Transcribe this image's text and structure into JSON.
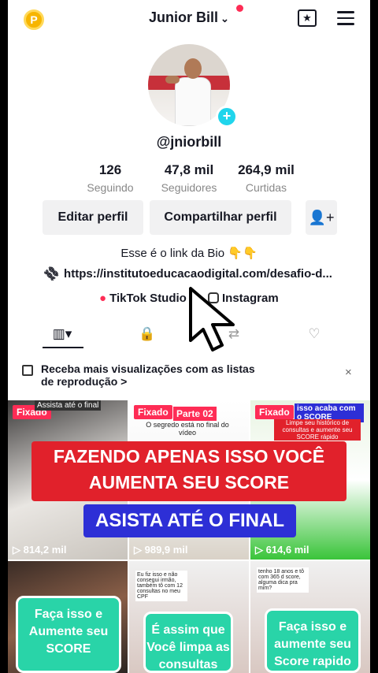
{
  "header": {
    "coin_label": "P",
    "username": "Junior Bill",
    "chevron": "⌄",
    "calendar_glyph": "★"
  },
  "profile": {
    "handle": "@jniorbill",
    "stats": [
      {
        "number": "126",
        "label": "Seguindo"
      },
      {
        "number": "47,8 mil",
        "label": "Seguidores"
      },
      {
        "number": "264,9 mil",
        "label": "Curtidas"
      }
    ],
    "edit_label": "Editar perfil",
    "share_label": "Compartilhar perfil",
    "add_friend_glyph": "👤+",
    "bio": "Esse é o link da Bio 👇👇",
    "link": "https://institutoeducacaodigital.com/desafio-d...",
    "studio_label": "TikTok Studio",
    "instagram_label": "Instagram"
  },
  "tabs": [
    {
      "name": "videos",
      "glyph": "▥▾"
    },
    {
      "name": "private",
      "glyph": "🔒"
    },
    {
      "name": "reposts",
      "glyph": "⇄"
    },
    {
      "name": "liked",
      "glyph": "♡"
    }
  ],
  "playlist_banner": {
    "text": "Receba mais visualizações com as listas de reprodução",
    "arrow": ">",
    "close": "×"
  },
  "videos": [
    {
      "pinned": "Fixado",
      "caption": "Assista até o final",
      "views": "814,2 mil"
    },
    {
      "pinned": "Fixado",
      "caption": "Parte 02",
      "sub": "O segredo está no final do vídeo",
      "views": "989,9 mil"
    },
    {
      "pinned": "Fixado",
      "caption": "isso acaba com o SCORE",
      "sub": "Limpe seu histórico de consultas e aumente seu SCORE rápido",
      "views": "614,6 mil"
    },
    {
      "card": "Faça isso e Aumente seu SCORE"
    },
    {
      "card": "É assim que Você limpa as consultas",
      "chat": "Eu fiz isso e não consegui irmão, também tô com 12 consultas no meu CPF"
    },
    {
      "card": "Faça isso e aumente seu Score rapido",
      "chat": "tenho 18 anos e tô com 365 d score, alguma dica pra mim?"
    }
  ],
  "overlay": {
    "line1": "FAZENDO APENAS ISSO VOCÊ",
    "line2": "AUMENTA SEU SCORE",
    "line3": "ASISTA ATÉ O FINAL"
  },
  "colors": {
    "brand_red": "#fe2c55",
    "overlay_red": "#e1212b",
    "overlay_blue": "#2d2fd6",
    "card_green": "#29d4a8",
    "plus_cyan": "#20d5ec"
  }
}
